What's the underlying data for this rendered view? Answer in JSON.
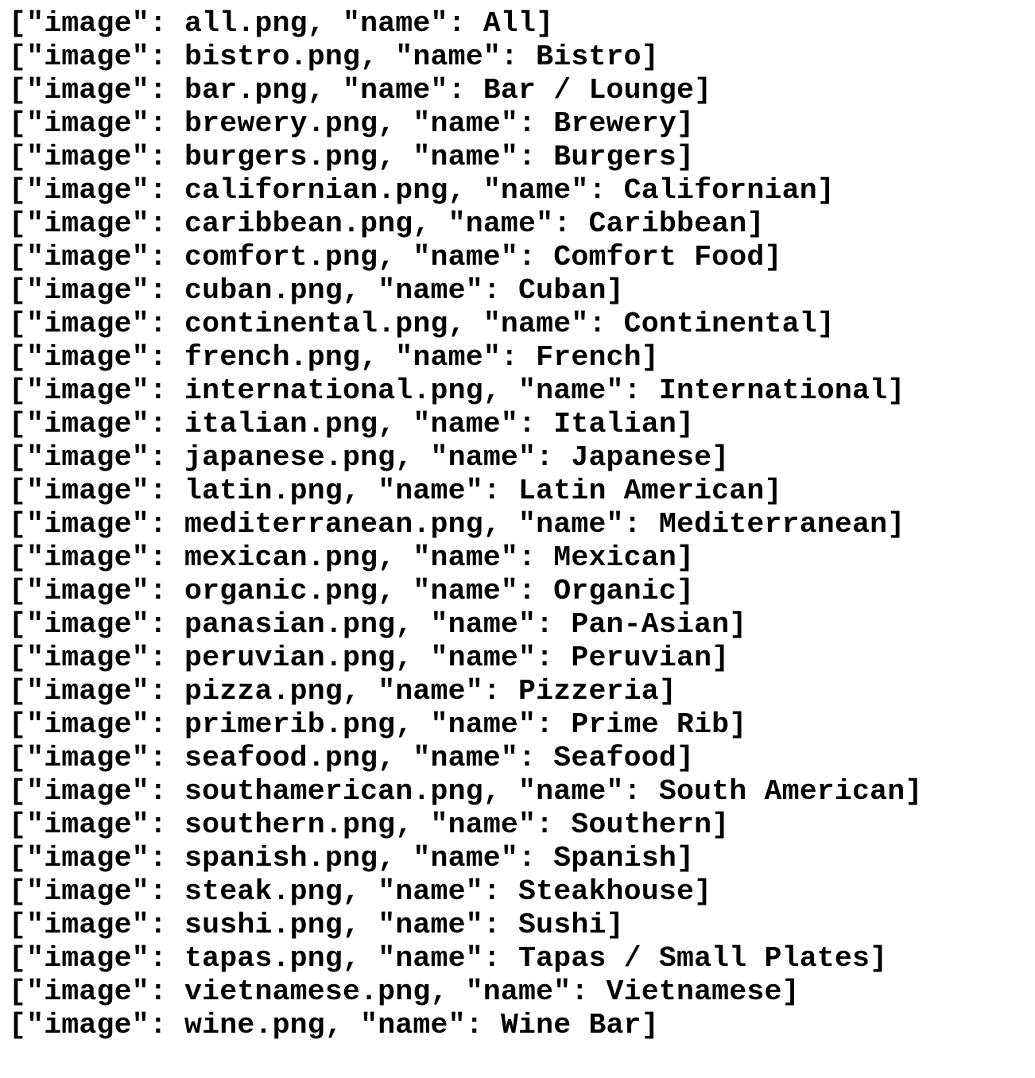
{
  "format": {
    "prefix": "[\"image\": ",
    "middle": ", \"name\": ",
    "suffix": "]"
  },
  "entries": [
    {
      "image": "all.png",
      "name": "All"
    },
    {
      "image": "bistro.png",
      "name": "Bistro"
    },
    {
      "image": "bar.png",
      "name": "Bar / Lounge"
    },
    {
      "image": "brewery.png",
      "name": "Brewery"
    },
    {
      "image": "burgers.png",
      "name": "Burgers"
    },
    {
      "image": "californian.png",
      "name": "Californian"
    },
    {
      "image": "caribbean.png",
      "name": "Caribbean"
    },
    {
      "image": "comfort.png",
      "name": "Comfort Food"
    },
    {
      "image": "cuban.png",
      "name": "Cuban"
    },
    {
      "image": "continental.png",
      "name": "Continental"
    },
    {
      "image": "french.png",
      "name": "French"
    },
    {
      "image": "international.png",
      "name": "International"
    },
    {
      "image": "italian.png",
      "name": "Italian"
    },
    {
      "image": "japanese.png",
      "name": "Japanese"
    },
    {
      "image": "latin.png",
      "name": "Latin American"
    },
    {
      "image": "mediterranean.png",
      "name": "Mediterranean"
    },
    {
      "image": "mexican.png",
      "name": "Mexican"
    },
    {
      "image": "organic.png",
      "name": "Organic"
    },
    {
      "image": "panasian.png",
      "name": "Pan-Asian"
    },
    {
      "image": "peruvian.png",
      "name": "Peruvian"
    },
    {
      "image": "pizza.png",
      "name": "Pizzeria"
    },
    {
      "image": "primerib.png",
      "name": "Prime Rib"
    },
    {
      "image": "seafood.png",
      "name": "Seafood"
    },
    {
      "image": "southamerican.png",
      "name": "South American"
    },
    {
      "image": "southern.png",
      "name": "Southern"
    },
    {
      "image": "spanish.png",
      "name": "Spanish"
    },
    {
      "image": "steak.png",
      "name": "Steakhouse"
    },
    {
      "image": "sushi.png",
      "name": "Sushi"
    },
    {
      "image": "tapas.png",
      "name": "Tapas / Small Plates"
    },
    {
      "image": "vietnamese.png",
      "name": "Vietnamese"
    },
    {
      "image": "wine.png",
      "name": "Wine Bar"
    }
  ]
}
